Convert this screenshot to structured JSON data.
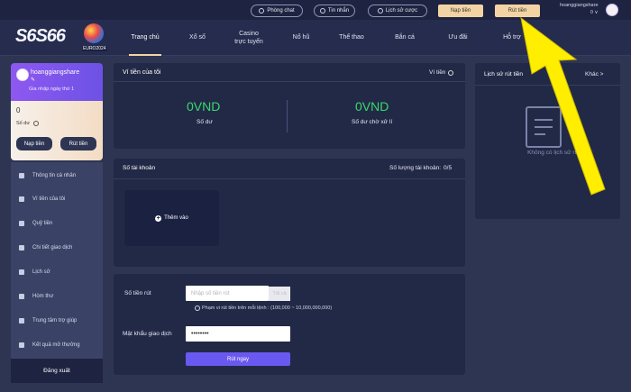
{
  "topbar": {
    "phongchat": "Phòng chat",
    "tinnhan": "Tin nhắn",
    "lichsucuoc": "Lịch sử cược",
    "naptien": "Nạp tiền",
    "ruttien": "Rút tiền",
    "username": "hoanggiangshare",
    "balance": "0 ∨"
  },
  "logo": {
    "text": "S6S66",
    "sub": "EURO2024"
  },
  "nav": [
    {
      "label": "Trang chủ"
    },
    {
      "label": "Xổ số"
    },
    {
      "label": "Casino\ntrực tuyến"
    },
    {
      "label": "Nổ hũ"
    },
    {
      "label": "Thể thao"
    },
    {
      "label": "Bắn cá"
    },
    {
      "label": "Ưu đãi"
    },
    {
      "label": "Hỗ trợ"
    }
  ],
  "profile": {
    "name": "hoanggiangshare",
    "joined": "Gia nhập ngày thứ 1",
    "balance": "0",
    "balance_label": "Số dư",
    "deposit": "Nạp tiền",
    "withdraw": "Rút tiền"
  },
  "menu": [
    {
      "label": "Thông tin cá nhân"
    },
    {
      "label": "Ví tiền của tôi"
    },
    {
      "label": "Quỹ tiền"
    },
    {
      "label": "Chi tiết giao dịch"
    },
    {
      "label": "Lịch sử"
    },
    {
      "label": "Hòm thư"
    },
    {
      "label": "Trung tâm trợ giúp"
    },
    {
      "label": "Kết quả mở thưởng"
    }
  ],
  "logout": "Đăng xuất",
  "wallet": {
    "title": "Ví tiền của tôi",
    "link": "Ví tiền",
    "balance_value": "0VND",
    "balance_label": "Số dư",
    "pending_value": "0VND",
    "pending_label": "Số dư chờ xử lí"
  },
  "accounts": {
    "title": "Số tài khoản",
    "count_label": "Số lượng tài khoản:",
    "count_value": "0/5",
    "add": "Thêm vào"
  },
  "withdraw_form": {
    "amount_label": "Số tiền rút",
    "amount_placeholder": "Nhập số tiền rút",
    "max": "Tất cả",
    "rule": "Phạm vi rút tiền trên mỗi lệnh : (100,000 ~ 10,000,000,000)",
    "password_label": "Mật khẩu giao dịch",
    "password_value": "••••••••",
    "submit": "Rút ngay"
  },
  "history": {
    "title": "Lịch sử rút tiền",
    "more": "Khác >",
    "empty": "Không có lịch sử rút"
  },
  "colors": {
    "accent": "#6a59f0",
    "gold": "#f2d3a3",
    "green": "#36d96d",
    "arrow": "#ffee00"
  }
}
